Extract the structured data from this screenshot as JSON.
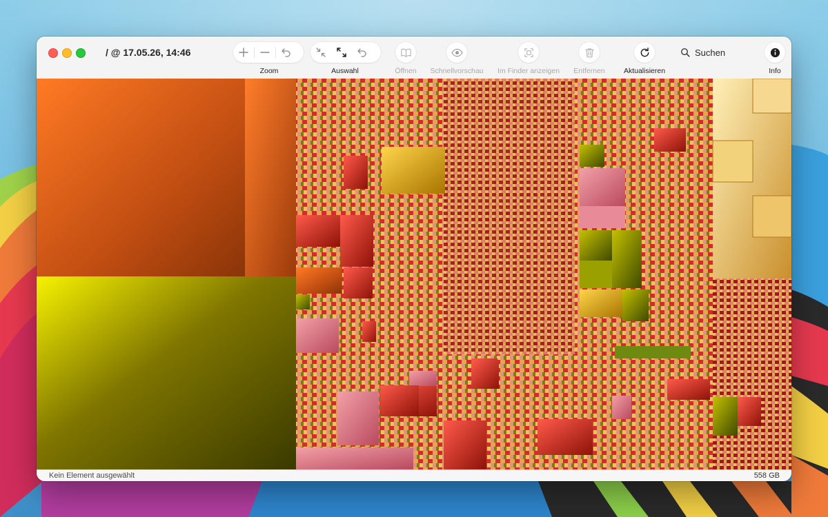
{
  "window": {
    "title": "/ @ 17.05.26, 14:46"
  },
  "toolbar": {
    "zoom": {
      "label": "Zoom",
      "zoom_in_icon": "plus-icon",
      "zoom_out_icon": "minus-icon",
      "back_icon": "undo-arrow-icon"
    },
    "selection": {
      "label": "Auswahl",
      "collapse_icon": "arrows-in-icon",
      "expand_icon": "arrows-out-icon",
      "back_icon": "undo-arrow-icon"
    },
    "open": {
      "label": "Öffnen",
      "icon": "book-icon",
      "enabled": false
    },
    "quicklook": {
      "label": "Schnellvorschau",
      "icon": "eye-icon",
      "enabled": false
    },
    "reveal": {
      "label": "Im Finder anzeigen",
      "icon": "finder-reveal-icon",
      "enabled": false
    },
    "remove": {
      "label": "Entfernen",
      "icon": "trash-icon",
      "enabled": false
    },
    "refresh": {
      "label": "Aktualisieren",
      "icon": "refresh-icon",
      "enabled": true
    },
    "search": {
      "label": "Suchen",
      "icon": "search-icon"
    },
    "info": {
      "label": "Info",
      "icon": "info-icon"
    }
  },
  "treemap": {
    "description_colors": [
      "#ff6a1a",
      "#e8e200",
      "#c81a24",
      "#e07a86",
      "#d8a832",
      "#7a8a10"
    ]
  },
  "status": {
    "selection_text": "Kein Element ausgewählt",
    "total_size": "558 GB"
  }
}
